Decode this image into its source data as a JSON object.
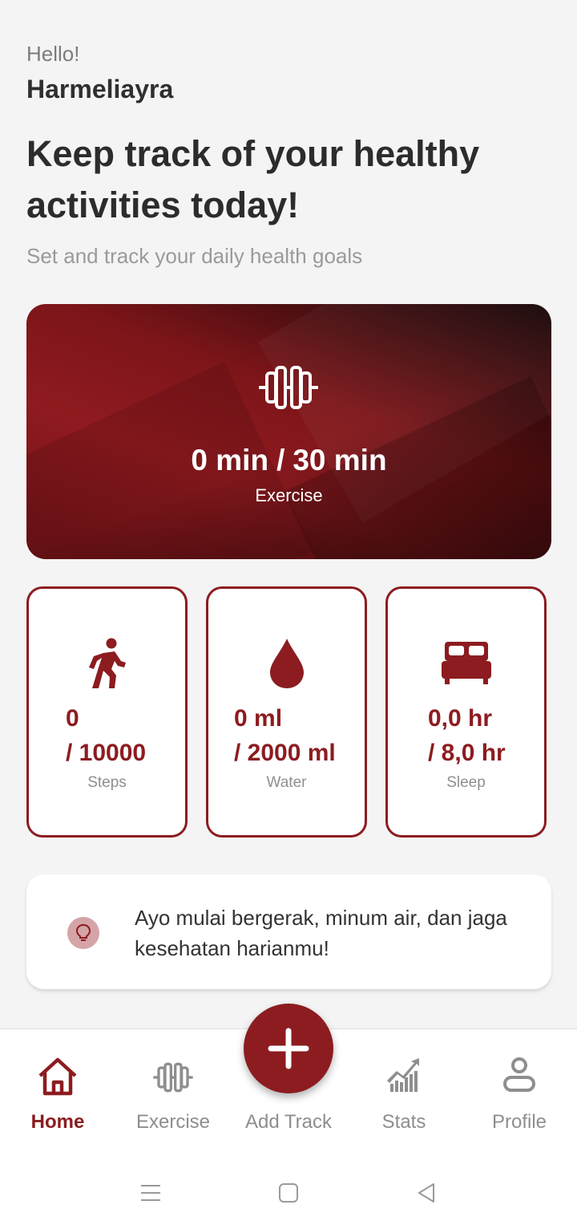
{
  "greeting": "Hello!",
  "username": "Harmeliayra",
  "headline": "Keep track of your healthy activities today!",
  "subheadline": "Set and track your daily health goals",
  "exercise": {
    "current": "0 min",
    "separator": "/",
    "goal": "30 min",
    "label": "Exercise",
    "icon": "dumbbell-icon"
  },
  "stats": {
    "steps": {
      "current": "0",
      "goal": "/ 10000",
      "label": "Steps",
      "icon": "running-person-icon"
    },
    "water": {
      "current": "0 ml",
      "goal": "/ 2000 ml",
      "label": "Water",
      "icon": "water-drop-icon"
    },
    "sleep": {
      "current": "0,0 hr",
      "goal": "/ 8,0 hr",
      "label": "Sleep",
      "icon": "bed-icon"
    }
  },
  "tip": {
    "text": "Ayo mulai bergerak, minum air, dan jaga kesehatan harianmu!",
    "icon": "lightbulb-icon"
  },
  "nav": {
    "items": [
      {
        "label": "Home",
        "icon": "home-icon",
        "active": true
      },
      {
        "label": "Exercise",
        "icon": "dumbbell-icon",
        "active": false
      },
      {
        "label": "Add Track",
        "icon": "plus-icon",
        "active": false
      },
      {
        "label": "Stats",
        "icon": "chart-icon",
        "active": false
      },
      {
        "label": "Profile",
        "icon": "user-icon",
        "active": false
      }
    ]
  },
  "colors": {
    "accent": "#8c1c20",
    "background": "#f4f4f4",
    "muted": "#8f8f8f"
  }
}
